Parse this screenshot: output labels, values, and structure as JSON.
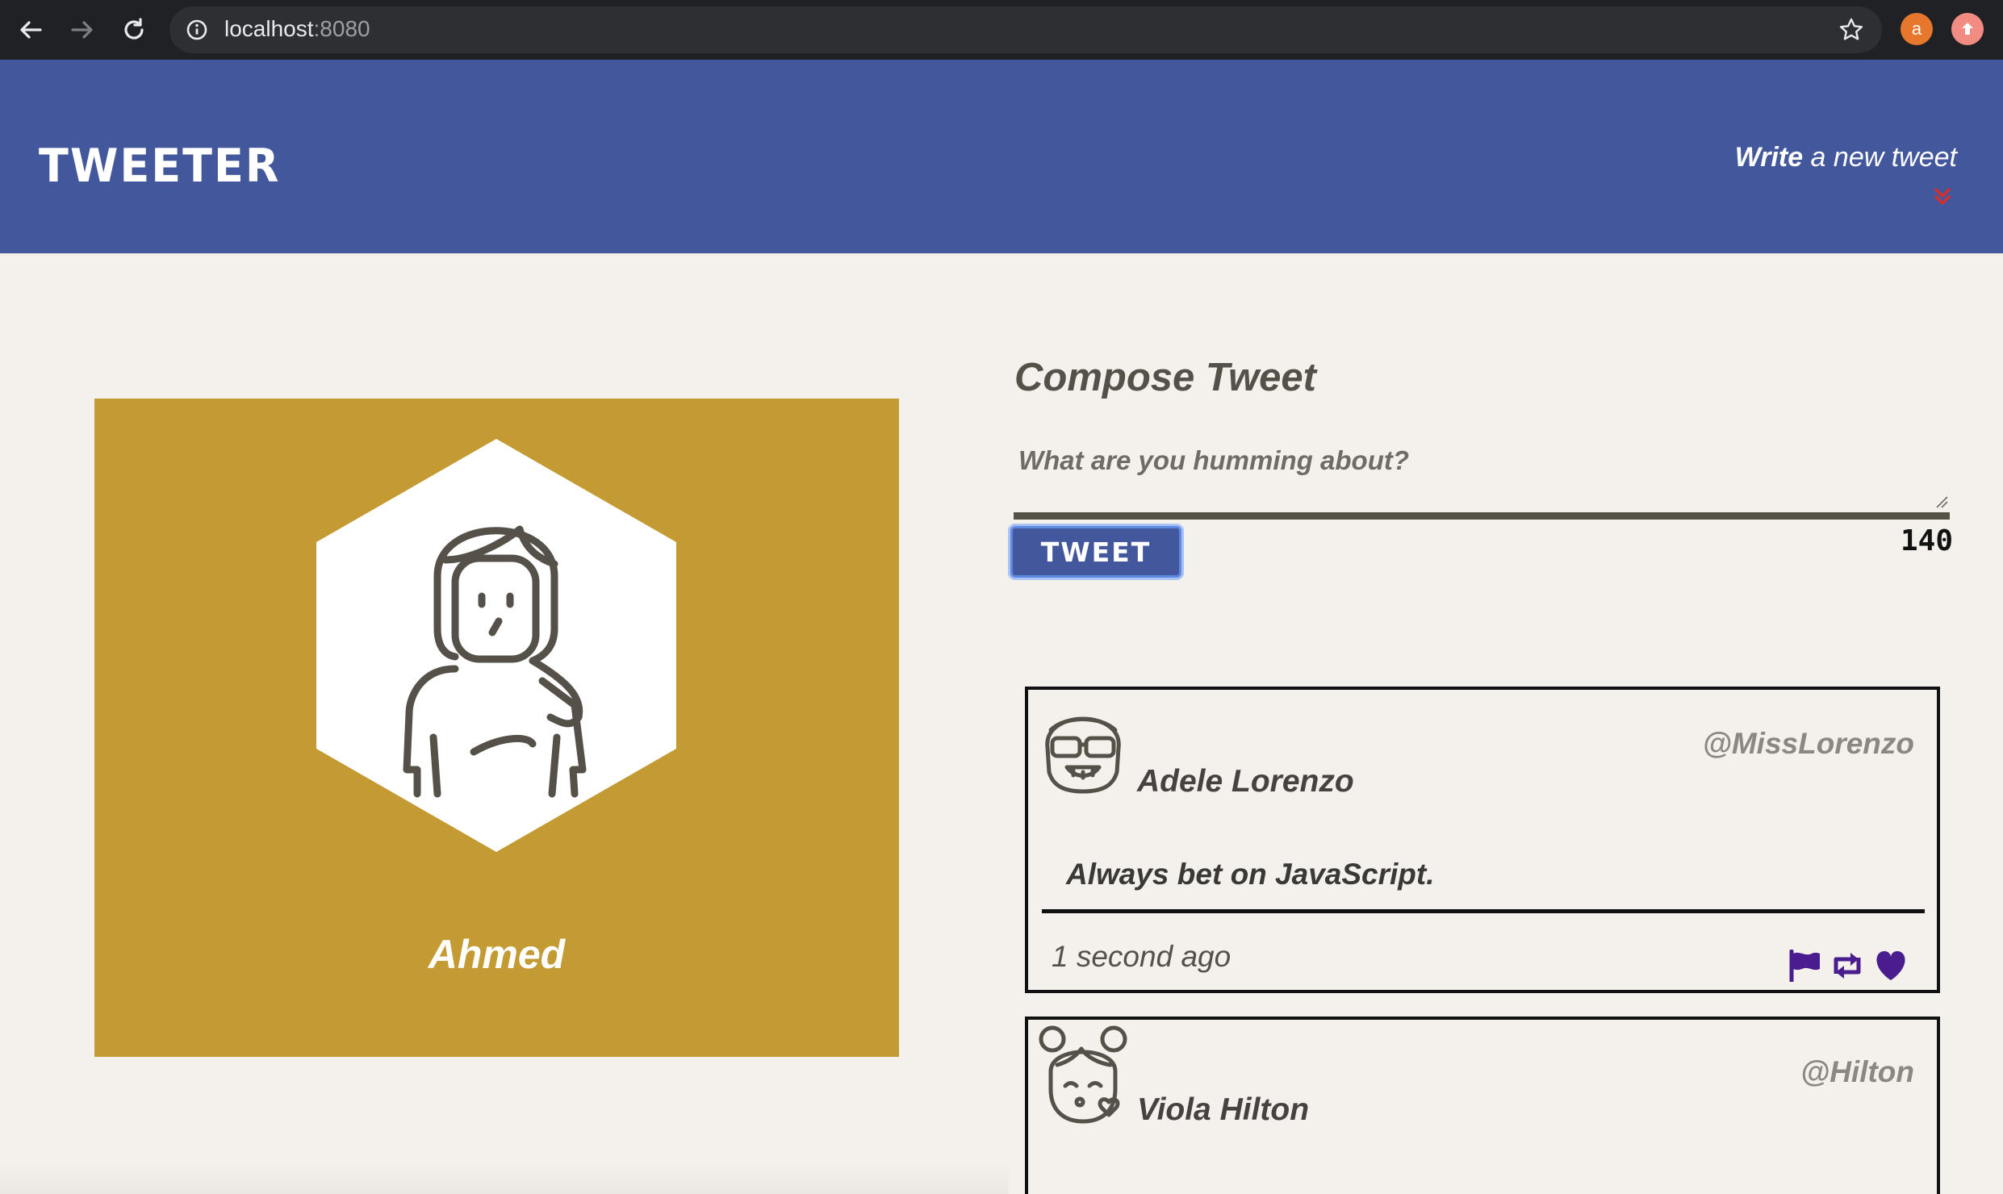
{
  "browser": {
    "url_host": "localhost",
    "url_port": ":8080",
    "extensions": [
      {
        "name": "a",
        "color": "#e8772e"
      },
      {
        "name": "",
        "color": "#f28b82"
      }
    ]
  },
  "header": {
    "brand": "TWEETER",
    "write_bold": "Write",
    "write_rest": " a new tweet",
    "chevron_color": "#d32f2f",
    "color": "#43579d"
  },
  "profile": {
    "name": "Ahmed",
    "card_color": "#c49a33"
  },
  "compose": {
    "title": "Compose Tweet",
    "placeholder": "What are you humming about?",
    "button_label": "TWEET",
    "counter": "140"
  },
  "tweets": [
    {
      "name": "Adele Lorenzo",
      "handle": "@MissLorenzo",
      "content": "Always bet on JavaScript.",
      "time": "1 second ago",
      "action_color": "#4a1d8e"
    },
    {
      "name": "Viola Hilton",
      "handle": "@Hilton"
    }
  ]
}
